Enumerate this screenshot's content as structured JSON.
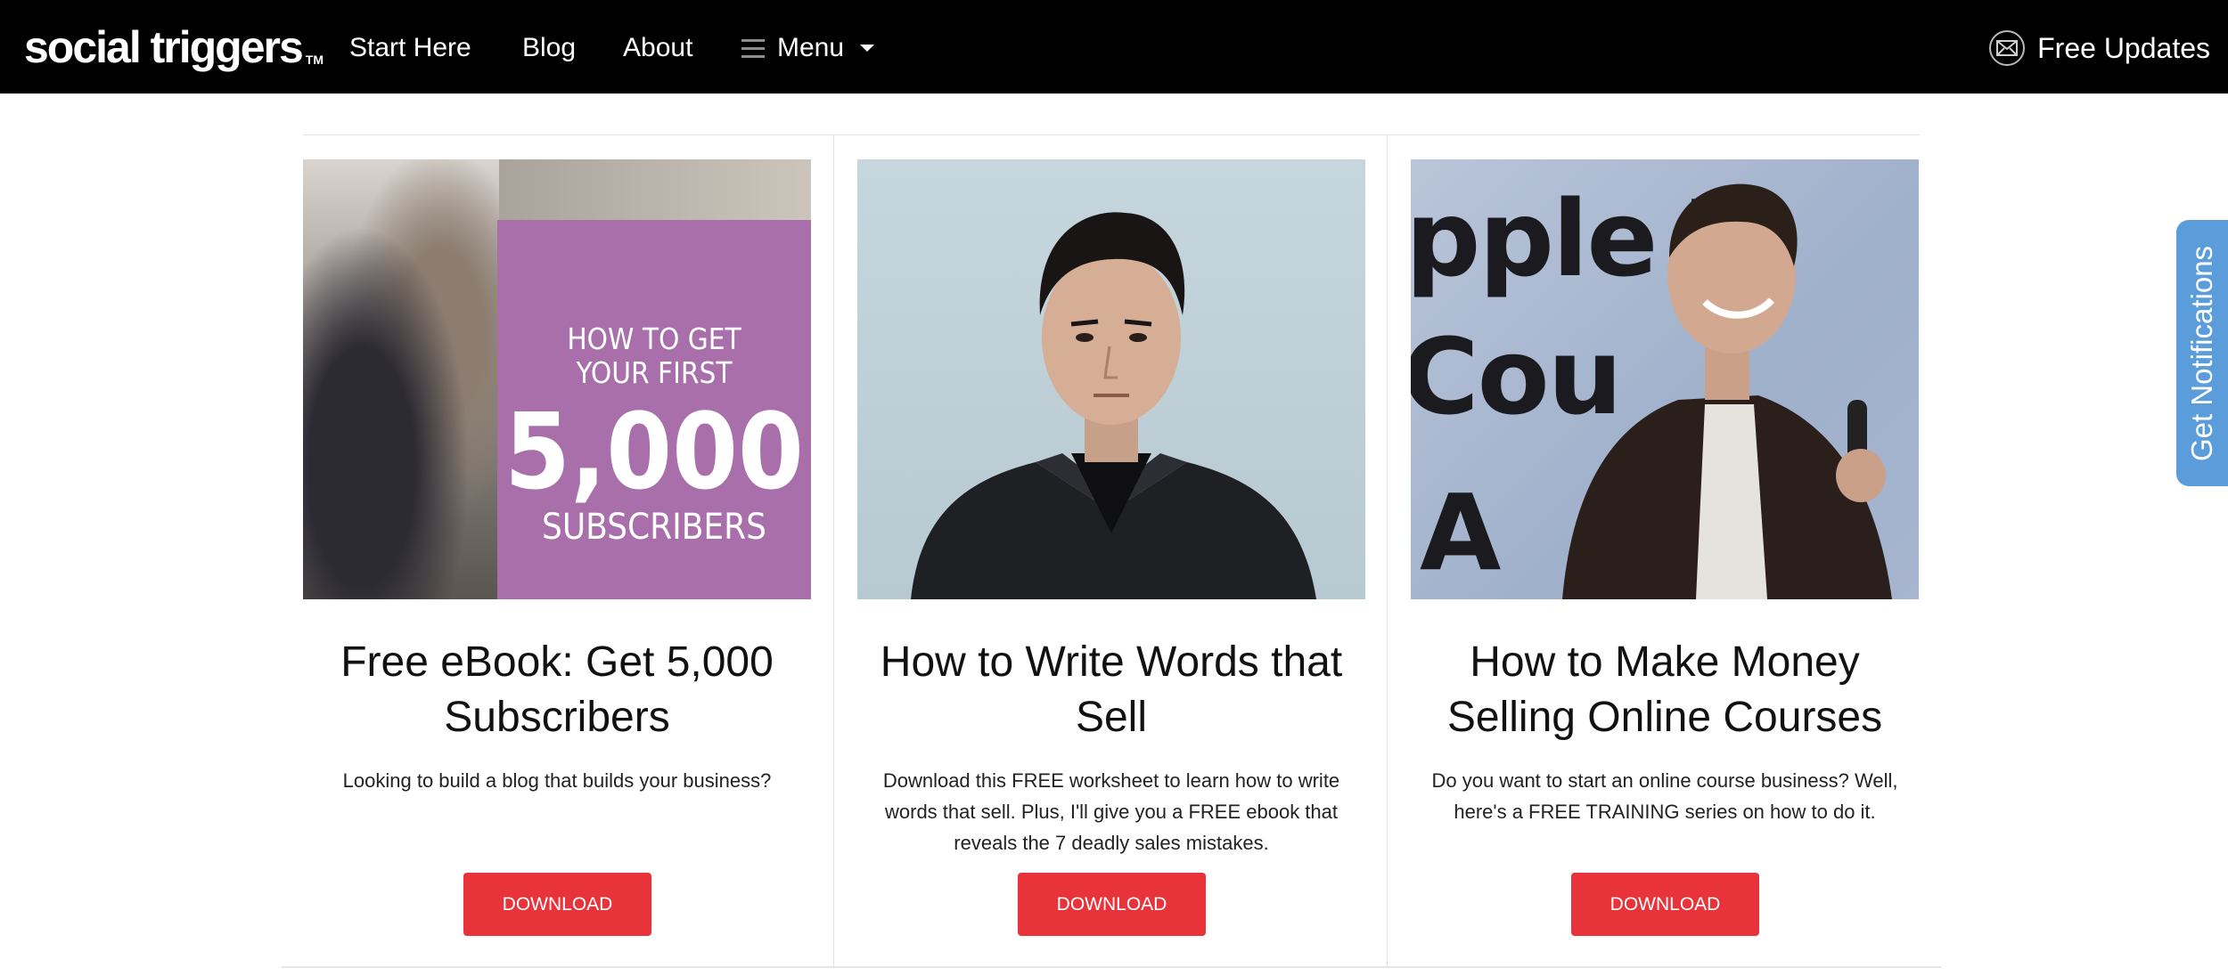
{
  "nav": {
    "logo": "social triggers",
    "logo_tm": "TM",
    "links": [
      "Start Here",
      "Blog",
      "About"
    ],
    "menu_label": "Menu",
    "free_updates": "Free Updates"
  },
  "cards": [
    {
      "image_text_line1": "HOW TO GET",
      "image_text_line2": "YOUR FIRST",
      "image_text_big": "5,000",
      "image_text_line3": "SUBSCRIBERS",
      "title": "Free eBook: Get 5,000 Subscribers",
      "description": "Looking to build a blog that builds your business?",
      "button": "DOWNLOAD"
    },
    {
      "title": "How to Write Words that Sell",
      "description": "Download this FREE worksheet to learn how to write words that sell. Plus, I'll give you a FREE ebook that reveals the 7 deadly sales mistakes.",
      "button": "DOWNLOAD"
    },
    {
      "title": "How to Make Money Selling Online Courses",
      "description": "Do you want to start an online course business? Well, here's a FREE TRAINING series on how to do it.",
      "button": "DOWNLOAD"
    }
  ],
  "side_tab": "Get Notifications",
  "colors": {
    "nav_bg": "#000000",
    "button_red": "#e8333b",
    "tab_blue": "#5b9ddb",
    "ebook_purple": "#a86faa"
  },
  "icons": [
    "mail-icon",
    "hamburger-icon",
    "caret-down-icon"
  ]
}
